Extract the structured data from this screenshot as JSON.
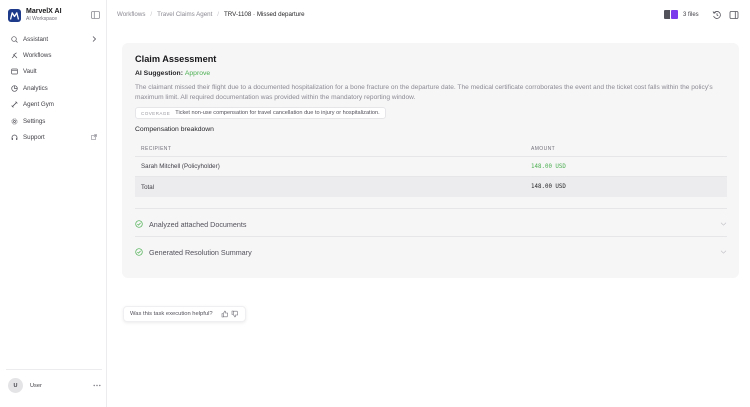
{
  "brand": {
    "name": "MarvelX AI",
    "subtitle": "AI Workspace"
  },
  "sidebar": {
    "items": [
      {
        "label": "Assistant",
        "icon": "chat-search-icon"
      },
      {
        "label": "Workflows",
        "icon": "workflow-icon"
      },
      {
        "label": "Vault",
        "icon": "folder-icon"
      },
      {
        "label": "Analytics",
        "icon": "chart-icon"
      },
      {
        "label": "Agent Gym",
        "icon": "dumbbell-icon"
      },
      {
        "label": "Settings",
        "icon": "gear-icon"
      },
      {
        "label": "Support",
        "icon": "headset-icon"
      }
    ],
    "user": {
      "initial": "U",
      "name": "User"
    }
  },
  "header": {
    "breadcrumbs": [
      "Workflows",
      "Travel Claims Agent",
      "TRV-1108 · Missed departure"
    ],
    "files_label": "3 files"
  },
  "card": {
    "title": "Claim Assessment",
    "suggestion_label": "AI Suggestion:",
    "suggestion_value": "Approve",
    "reasoning": "The claimant missed their flight due to a documented hospitalization for a bone fracture on the departure date. The medical certificate corroborates the event and the ticket cost falls within the policy's maximum limit. All required documentation was provided within the mandatory reporting window.",
    "coverage_tag": "COVERAGE",
    "coverage_text": "Ticket non-use compensation for travel cancellation due to injury or hospitalization.",
    "breakdown_title": "Compensation breakdown",
    "table": {
      "headers": [
        "RECIPIENT",
        "AMOUNT"
      ],
      "rows": [
        {
          "recipient": "Sarah Mitchell (Policyholder)",
          "amount": "148.00 USD"
        }
      ],
      "total": {
        "label": "Total",
        "amount": "148.00 USD"
      }
    },
    "sections": [
      {
        "label": "Analyzed attached Documents"
      },
      {
        "label": "Generated Resolution Summary"
      }
    ]
  },
  "feedback": {
    "question": "Was this task execution helpful?"
  },
  "colors": {
    "accent": "#1e3a8a",
    "approve": "#4caf50",
    "card_bg": "#f6f6f7"
  }
}
